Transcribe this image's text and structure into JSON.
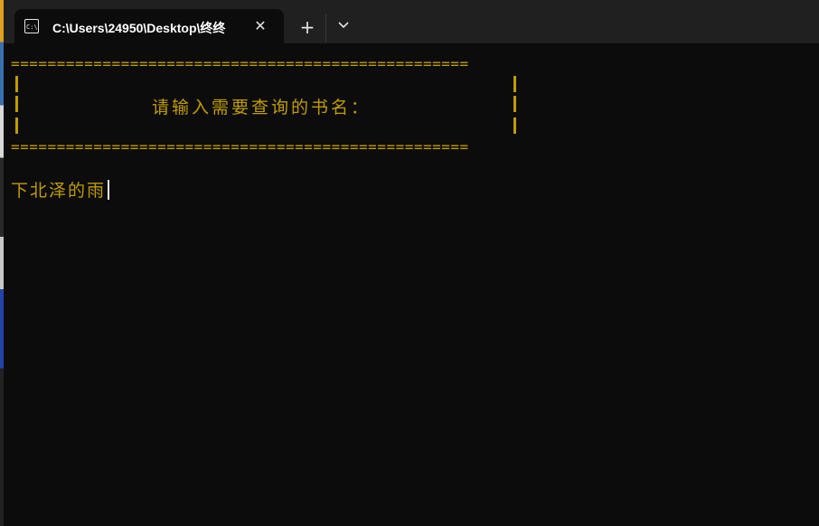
{
  "window": {
    "tab_title": "C:\\Users\\24950\\Desktop\\终终",
    "tab_icon": "terminal-icon",
    "close_glyph": "✕",
    "new_tab_glyph": "+",
    "dropdown_icon": "chevron-down-icon"
  },
  "terminal": {
    "border_rule": "==================================================",
    "prompt": "请输入需要查询的书名：",
    "input_value": "下北泽的雨",
    "text_color": "#c19c00",
    "background_color": "#0c0c0c"
  }
}
